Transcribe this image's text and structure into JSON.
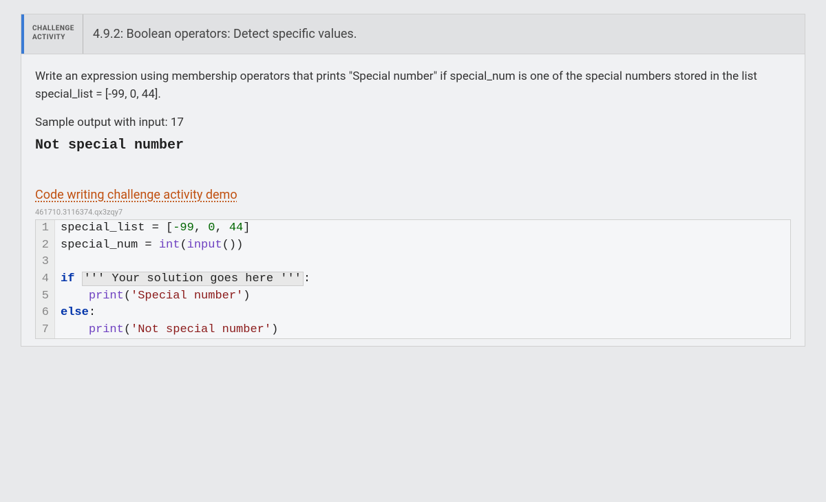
{
  "header": {
    "activity_label": "CHALLENGE\nACTIVITY",
    "title": "4.9.2: Boolean operators: Detect specific values."
  },
  "body": {
    "prompt": "Write an expression using membership operators that prints \"Special number\" if special_num is one of the special numbers stored in the list special_list = [-99, 0, 44].",
    "sample_label": "Sample output with input: 17",
    "sample_output": "Not special number",
    "demo_link": "Code writing challenge activity demo",
    "watermark": "461710.3116374.qx3zqy7"
  },
  "code": {
    "lines": [
      {
        "n": "1",
        "plain": "special_list = [-99, 0, 44]"
      },
      {
        "n": "2",
        "plain": "special_num = int(input())"
      },
      {
        "n": "3",
        "plain": ""
      },
      {
        "n": "4",
        "plain": "if ''' Your solution goes here ''':"
      },
      {
        "n": "5",
        "plain": "    print('Special number')"
      },
      {
        "n": "6",
        "plain": "else:"
      },
      {
        "n": "7",
        "plain": "    print('Not special number')"
      }
    ],
    "tokens": {
      "special_list": "special_list",
      "special_num": "special_num",
      "eq": " = ",
      "lbracket": "[",
      "neg99": "-99",
      "comma_sp": ", ",
      "zero": "0",
      "fortyfour": "44",
      "rbracket": "]",
      "int": "int",
      "lparen": "(",
      "input": "input",
      "rparen": ")",
      "rparen2": ")",
      "if": "if ",
      "placeholder": "''' Your solution goes here '''",
      "colon": ":",
      "indent": "    ",
      "print": "print",
      "str_special": "'Special number'",
      "else": "else",
      "str_not_special": "'Not special number'"
    }
  }
}
